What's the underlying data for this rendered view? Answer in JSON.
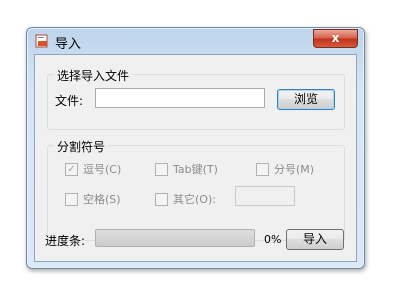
{
  "window": {
    "title": "导入",
    "close_label": "x"
  },
  "file_group": {
    "title": "选择导入文件",
    "file_label": "文件:",
    "file_value": "",
    "browse_label": "浏览"
  },
  "separator_group": {
    "title": "分割符号",
    "options": [
      {
        "label": "逗号(C)",
        "checked": true
      },
      {
        "label": "Tab键(T)",
        "checked": false
      },
      {
        "label": "分号(M)",
        "checked": false
      },
      {
        "label": "空格(S)",
        "checked": false
      },
      {
        "label": "其它(O):",
        "checked": false
      }
    ],
    "other_value": ""
  },
  "progress": {
    "label": "进度条:",
    "percent_text": "0%",
    "value": 0
  },
  "import_button_label": "导入"
}
